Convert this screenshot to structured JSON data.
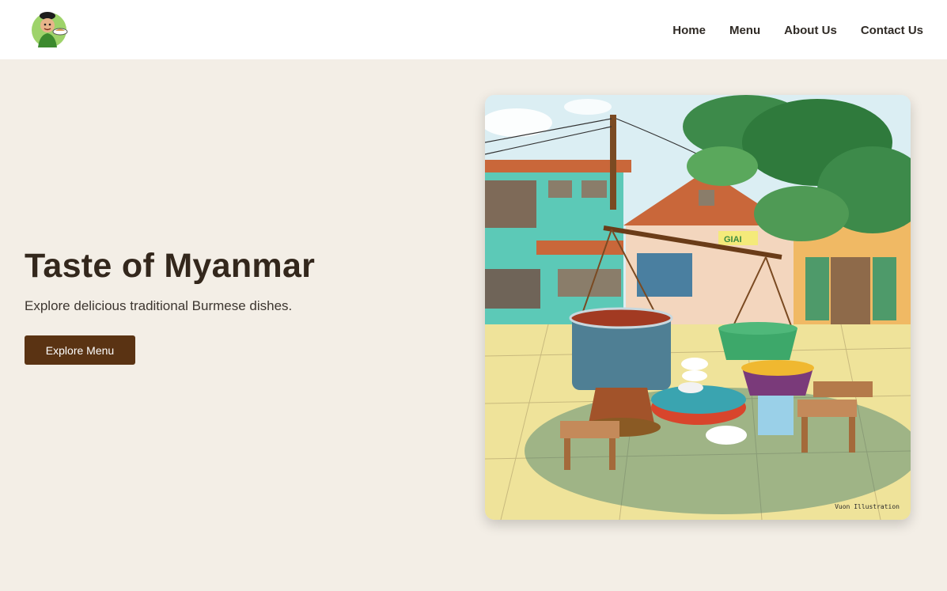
{
  "header": {
    "logo_icon": "chef-mascot-icon",
    "nav": [
      {
        "label": "Home"
      },
      {
        "label": "Menu"
      },
      {
        "label": "About Us"
      },
      {
        "label": "Contact Us"
      }
    ]
  },
  "hero": {
    "title": "Taste of Myanmar",
    "subtitle": "Explore delicious traditional Burmese dishes.",
    "button_label": "Explore Menu",
    "image": {
      "icon": "street-food-illustration",
      "credit": "Vuon Illustration",
      "sign_text": "GIAI"
    }
  },
  "colors": {
    "background": "#f3eee6",
    "header": "#ffffff",
    "button": "#5a3313",
    "title": "#33271c"
  }
}
